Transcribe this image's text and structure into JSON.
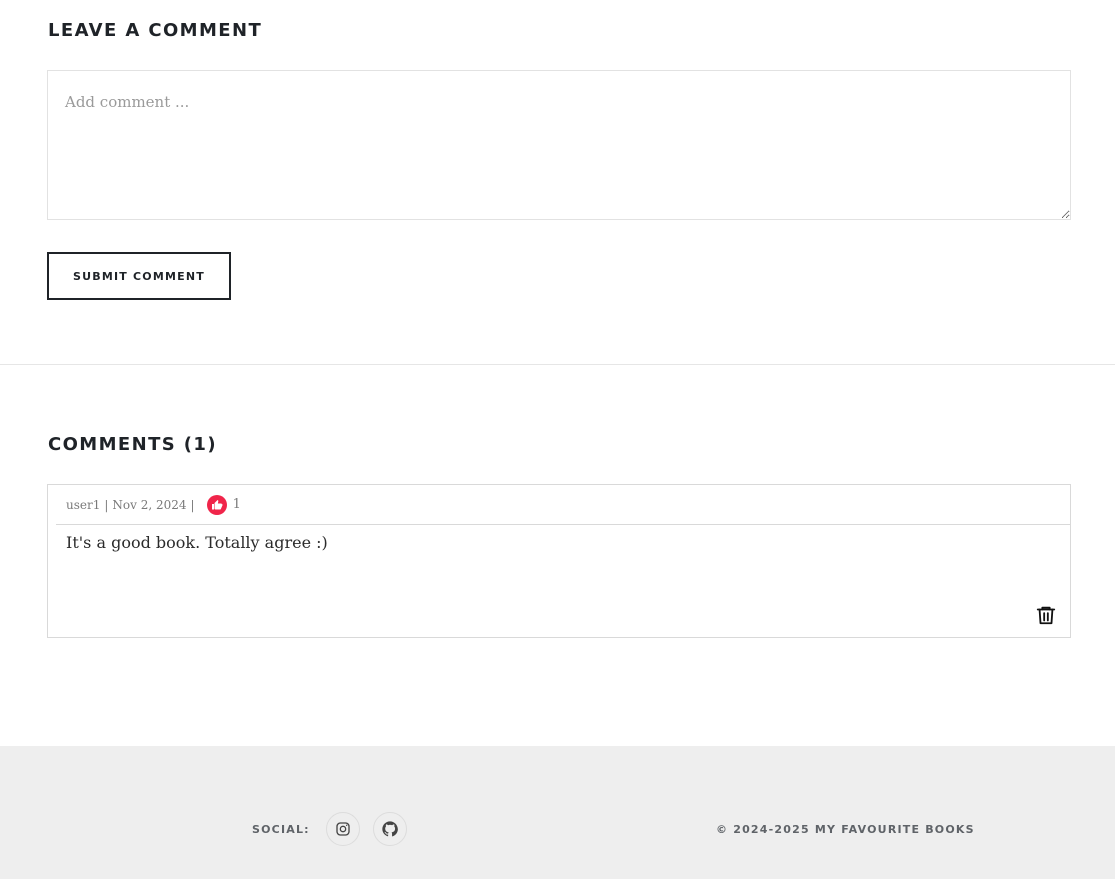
{
  "leave_comment": {
    "heading": "LEAVE A COMMENT",
    "placeholder": "Add comment ...",
    "value": "",
    "submit_label": "SUBMIT COMMENT"
  },
  "comments": {
    "heading": "COMMENTS (1)",
    "items": [
      {
        "user": "user1",
        "date": "Nov 2, 2024",
        "likes": "1",
        "text": "It's a good book. Totally agree :)",
        "like_icon": "thumbs-up-icon",
        "delete_icon": "trash-icon"
      }
    ]
  },
  "footer": {
    "social_label": "SOCIAL:",
    "social_links": [
      {
        "icon": "instagram-icon"
      },
      {
        "icon": "github-icon"
      }
    ],
    "copyright": "© 2024-2025 MY FAVOURITE BOOKS"
  },
  "colors": {
    "like_accent": "#f0254a",
    "footer_background": "#eeeeee",
    "text_dark": "#1f2328"
  }
}
